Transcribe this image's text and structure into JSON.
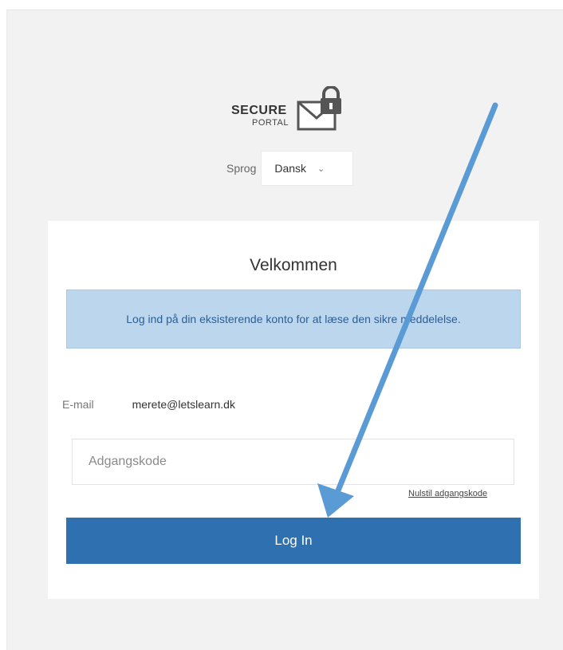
{
  "logo": {
    "secure_text": "SECURE",
    "portal_text": "PORTAL",
    "icon": "envelope-lock-icon"
  },
  "language": {
    "label": "Sprog",
    "selected": "Dansk"
  },
  "card": {
    "title": "Velkommen",
    "info_message": "Log ind på din eksisterende konto for at læse den sikre meddelelse.",
    "email_label": "E-mail",
    "email_value": "merete@letslearn.dk",
    "password_placeholder": "Adgangskode",
    "reset_link": "Nulstil adgangskode",
    "login_button": "Log In"
  },
  "annotation": {
    "arrow_color": "#5b9bd5"
  },
  "colors": {
    "page_background": "#f2f2f2",
    "info_background": "#bcd6ee",
    "info_text": "#2b5f94",
    "button_background": "#2f70b0"
  }
}
